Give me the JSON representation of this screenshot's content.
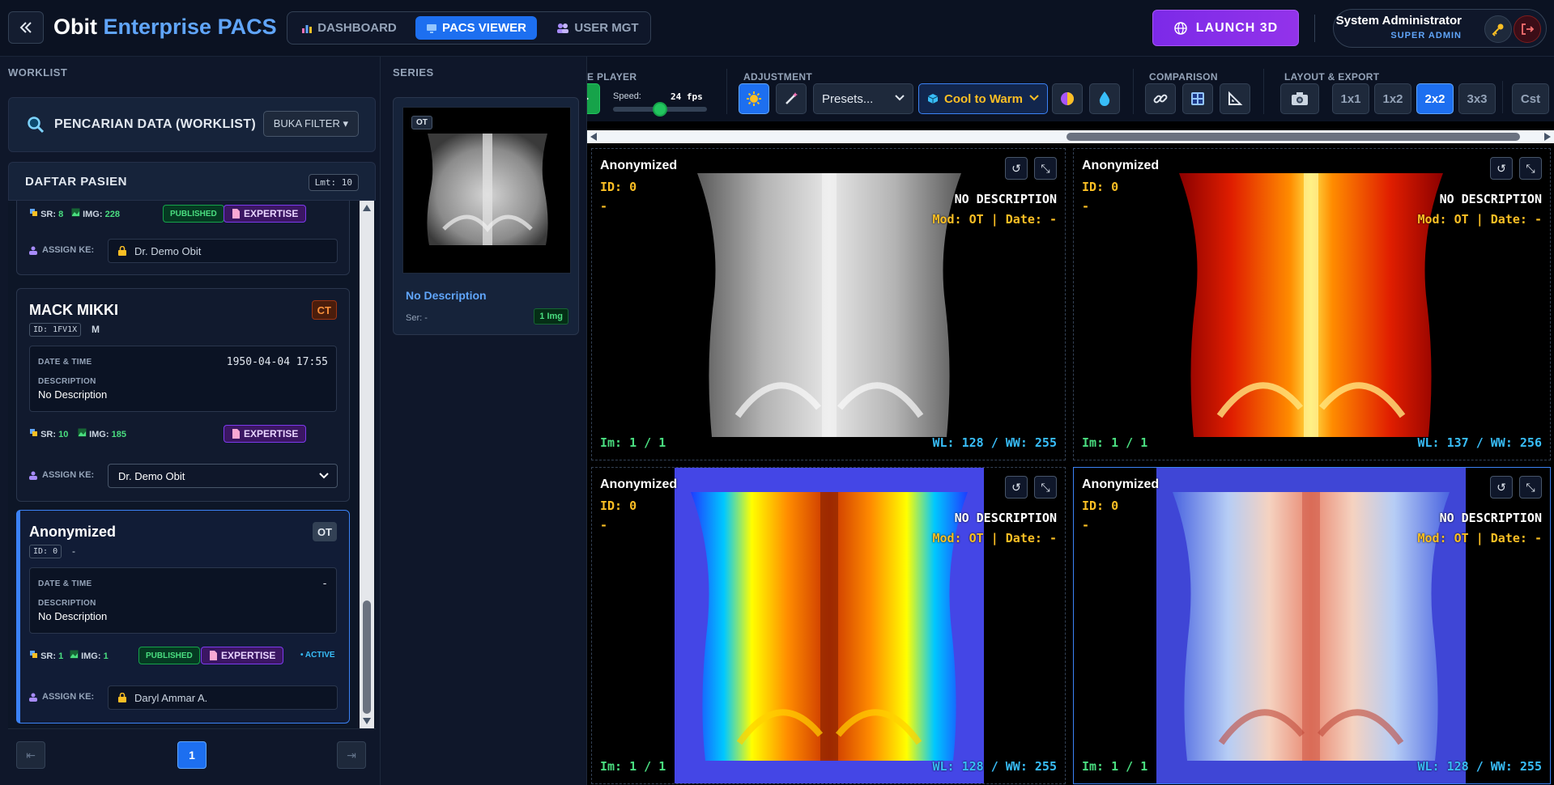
{
  "header": {
    "brand_main": "Obit",
    "brand_accent": "Enterprise PACS",
    "tabs": [
      {
        "label": "DASHBOARD",
        "icon": "bar-chart-icon"
      },
      {
        "label": "PACS VIEWER",
        "icon": "monitor-icon"
      },
      {
        "label": "USER MGT",
        "icon": "users-icon"
      }
    ],
    "active_tab": "PACS VIEWER",
    "launch_label": "LAUNCH 3D",
    "user_name": "System Administrator",
    "user_role": "SUPER ADMIN"
  },
  "worklist": {
    "title": "WORKLIST",
    "search_title": "PENCARIAN DATA (WORKLIST)",
    "filter_label": "BUKA FILTER ▾",
    "list_title": "DAFTAR PASIEN",
    "limit_label": "Lmt: 10",
    "patients": [
      {
        "sr_label": "SR:",
        "sr": "8",
        "img_label": "IMG:",
        "img": "228",
        "published": "PUBLISHED",
        "expertise": "EXPERTISE",
        "assign_label": "ASSIGN KE:",
        "assign": "Dr. Demo Obit"
      },
      {
        "name": "MACK MIKKI",
        "modality": "CT",
        "id": "ID: 1FV1X",
        "sex": "M",
        "date_label": "DATE & TIME",
        "date": "1950-04-04 17:55",
        "desc_label": "DESCRIPTION",
        "desc": "No Description",
        "sr_label": "SR:",
        "sr": "10",
        "img_label": "IMG:",
        "img": "185",
        "expertise": "EXPERTISE",
        "assign_label": "ASSIGN KE:",
        "assign": "Dr. Demo Obit"
      },
      {
        "name": "Anonymized",
        "modality": "OT",
        "id": "ID: 0",
        "sex": "-",
        "date_label": "DATE & TIME",
        "date": "-",
        "desc_label": "DESCRIPTION",
        "desc": "No Description",
        "sr_label": "SR:",
        "sr": "1",
        "img_label": "IMG:",
        "img": "1",
        "published": "PUBLISHED",
        "expertise": "EXPERTISE",
        "active": "• ACTIVE",
        "assign_label": "ASSIGN KE:",
        "assign": "Daryl Ammar A."
      }
    ],
    "page_prev": "⇤",
    "page_current": "1",
    "page_next": "⇥"
  },
  "series": {
    "title": "SERIES",
    "item": {
      "modality": "OT",
      "title": "No Description",
      "ser": "Ser: -",
      "img_count": "1 Img"
    }
  },
  "toolbar": {
    "player_title": "E PLAYER",
    "speed_label": "Speed:",
    "speed_value": "24 fps",
    "speed_fraction": 0.5,
    "adjustment_title": "ADJUSTMENT",
    "presets_value": "Presets...",
    "colormap_value": "Cool to Warm",
    "comparison_title": "COMPARISON",
    "layout_title": "LAYOUT & EXPORT",
    "layouts": [
      "1x1",
      "1x2",
      "2x2",
      "3x3",
      "Cst"
    ],
    "active_layout": "2x2"
  },
  "viewports": [
    {
      "name": "Anonymized",
      "id": "ID: 0",
      "dash": "-",
      "desc": "NO DESCRIPTION",
      "mod": "Mod: OT | Date: -",
      "im": "Im: 1 / 1",
      "wl": "WL: 128 / WW: 255",
      "colormap": "grayscale"
    },
    {
      "name": "Anonymized",
      "id": "ID: 0",
      "dash": "-",
      "desc": "NO DESCRIPTION",
      "mod": "Mod: OT | Date: -",
      "im": "Im: 1 / 1",
      "wl": "WL: 137 / WW: 256",
      "colormap": "hot"
    },
    {
      "name": "Anonymized",
      "id": "ID: 0",
      "dash": "-",
      "desc": "NO DESCRIPTION",
      "mod": "Mod: OT | Date: -",
      "im": "Im: 1 / 1",
      "wl": "WL: 128 / WW: 255",
      "colormap": "jet"
    },
    {
      "name": "Anonymized",
      "id": "ID: 0",
      "dash": "-",
      "desc": "NO DESCRIPTION",
      "mod": "Mod: OT | Date: -",
      "im": "Im: 1 / 1",
      "wl": "WL: 128 / WW: 255",
      "colormap": "cool-to-warm"
    }
  ],
  "colors": {
    "accent": "#1d6ff0",
    "launch": "#9333ea",
    "green": "#4ade80",
    "amber": "#fbbf24",
    "cyan": "#38bdf8"
  }
}
